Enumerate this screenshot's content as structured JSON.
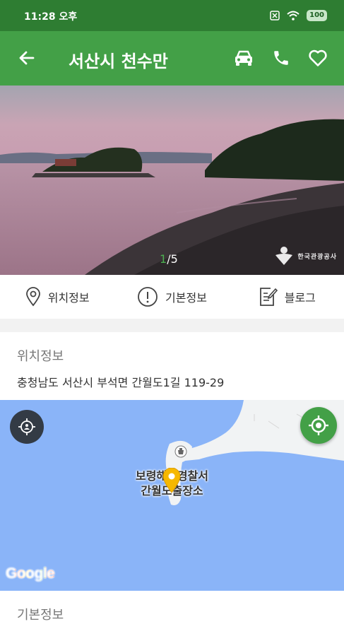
{
  "status_bar": {
    "time": "11:28 오후",
    "battery": "100"
  },
  "app_bar": {
    "title": "서산시 천수만",
    "back_icon": "arrow-back-icon",
    "actions": [
      {
        "name": "directions-car-button",
        "icon": "car-icon"
      },
      {
        "name": "call-button",
        "icon": "phone-icon"
      },
      {
        "name": "favorite-button",
        "icon": "heart-outline-icon"
      }
    ]
  },
  "gallery": {
    "current": "1",
    "counter": "/5",
    "credit_logo": "한국관광공사"
  },
  "info_tabs": [
    {
      "label": "위치정보",
      "icon": "location-pin-icon"
    },
    {
      "label": "기본정보",
      "icon": "info-exclamation-icon"
    },
    {
      "label": "블로그",
      "icon": "edit-note-icon"
    }
  ],
  "location_section": {
    "title": "위치정보",
    "address": "충청남도 서산시 부석면 간월도1길 119-29"
  },
  "map": {
    "poi_line1": "보령해양경찰서",
    "poi_line2": "간월도출장소",
    "attribution": "Google",
    "water_color": "#8ab4f8",
    "land_color": "#f1f3f4"
  },
  "basic_section": {
    "title": "기본정보"
  },
  "colors": {
    "primary": "#43a047",
    "primary_dark": "#2e7d32"
  }
}
